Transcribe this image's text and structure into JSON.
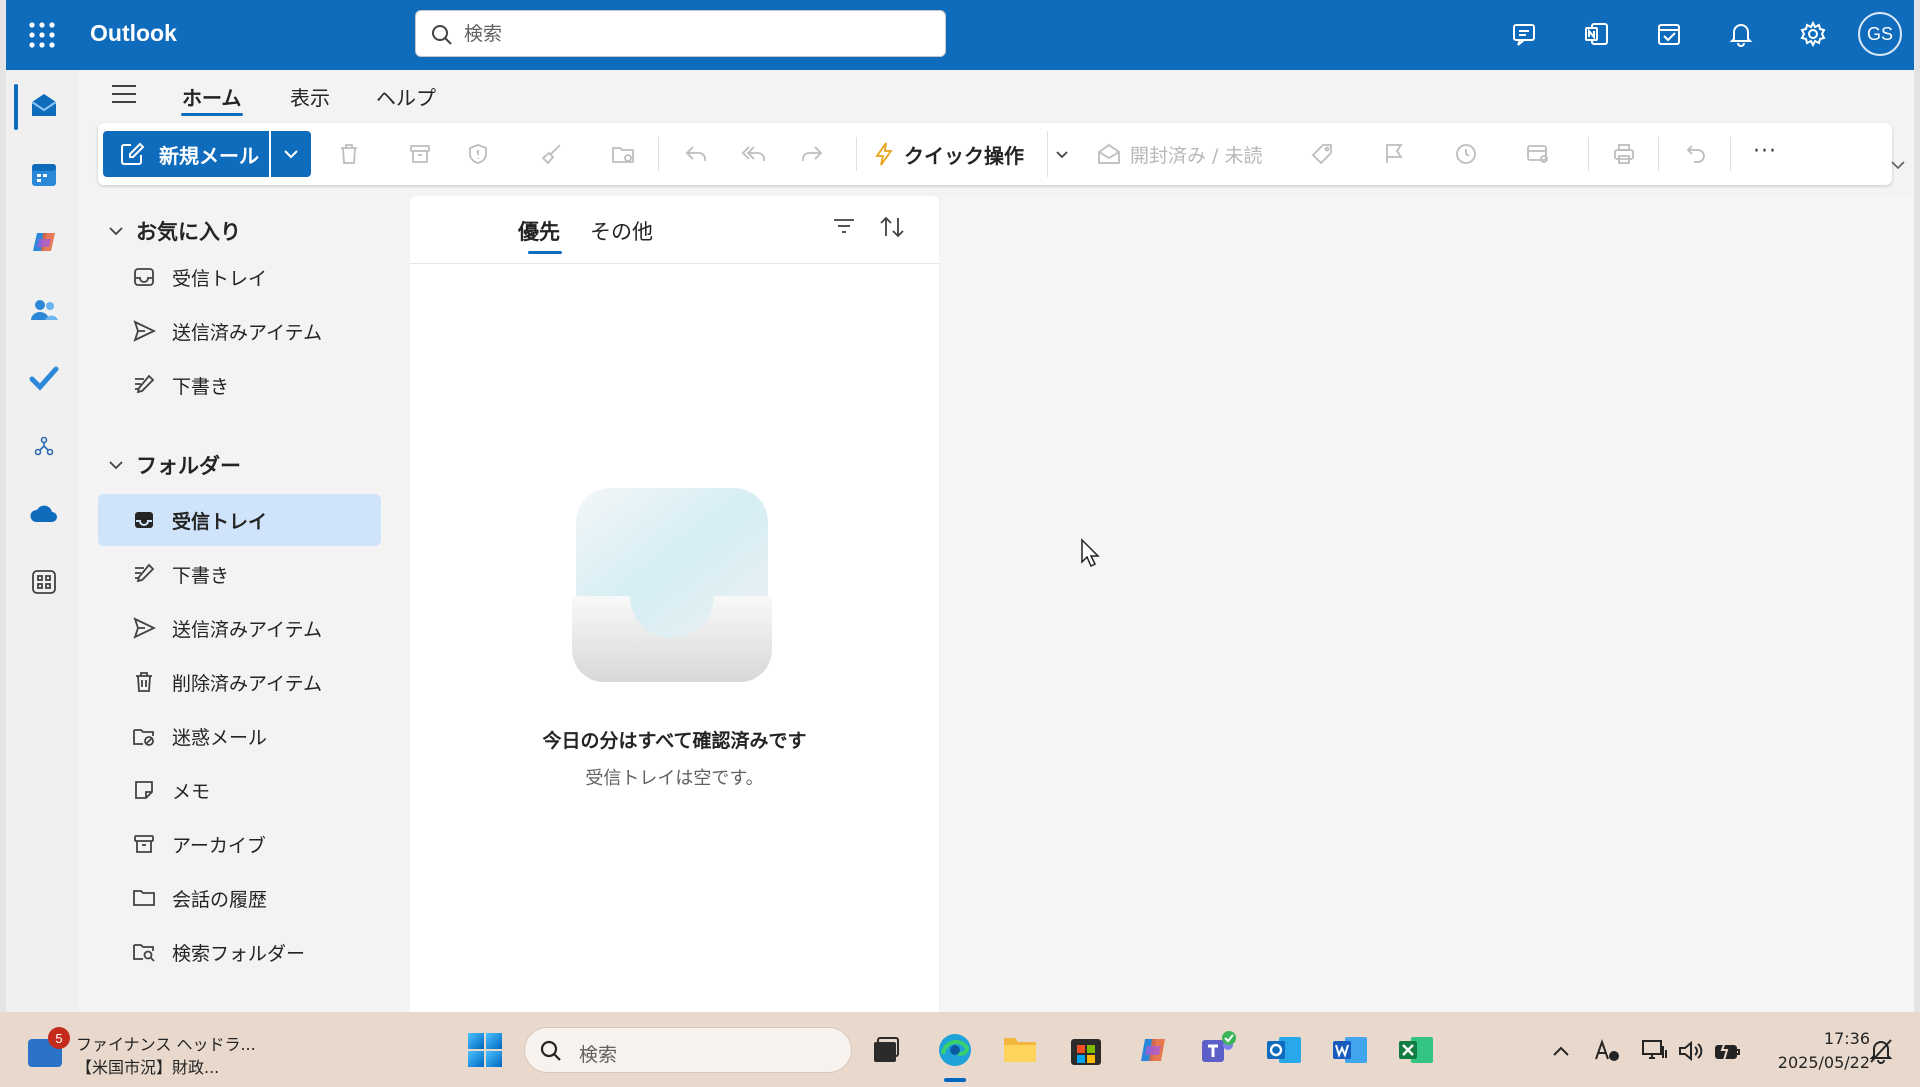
{
  "header": {
    "app_name": "Outlook",
    "search_placeholder": "検索",
    "avatar_initials": "GS",
    "accent_color": "#0f6cbd"
  },
  "ribbon": {
    "tabs": [
      {
        "label": "ホーム",
        "active": true
      },
      {
        "label": "表示",
        "active": false
      },
      {
        "label": "ヘルプ",
        "active": false
      }
    ],
    "new_mail_label": "新規メール",
    "quick_steps_label": "クイック操作",
    "read_unread_label": "開封済み / 未読",
    "more_label": "···"
  },
  "folders": {
    "favorites_label": "お気に入り",
    "favorites": [
      {
        "label": "受信トレイ",
        "icon": "inbox-icon"
      },
      {
        "label": "送信済みアイテム",
        "icon": "send-icon"
      },
      {
        "label": "下書き",
        "icon": "draft-icon"
      }
    ],
    "folders_label": "フォルダー",
    "items": [
      {
        "label": "受信トレイ",
        "icon": "inbox-icon",
        "selected": true
      },
      {
        "label": "下書き",
        "icon": "draft-icon"
      },
      {
        "label": "送信済みアイテム",
        "icon": "send-icon"
      },
      {
        "label": "削除済みアイテム",
        "icon": "trash-icon"
      },
      {
        "label": "迷惑メール",
        "icon": "junk-icon"
      },
      {
        "label": "メモ",
        "icon": "note-icon"
      },
      {
        "label": "アーカイブ",
        "icon": "archive-icon"
      },
      {
        "label": "会話の履歴",
        "icon": "folder-icon"
      },
      {
        "label": "検索フォルダー",
        "icon": "search-folder-icon"
      }
    ]
  },
  "message_list": {
    "tabs": [
      {
        "label": "優先",
        "active": true
      },
      {
        "label": "その他",
        "active": false
      }
    ],
    "empty_title": "今日の分はすべて確認済みです",
    "empty_subtitle": "受信トレイは空です。"
  },
  "taskbar": {
    "news_badge": "5",
    "news_line1": "ファイナンス ヘッドラ...",
    "news_line2": "【米国市況】財政...",
    "search_placeholder": "検索",
    "time": "17:36",
    "date": "2025/05/22"
  }
}
